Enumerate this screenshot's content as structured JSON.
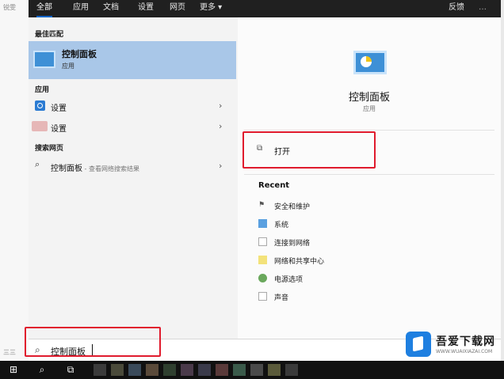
{
  "tabs": [
    {
      "label": "全部",
      "active": true
    },
    {
      "label": "应用"
    },
    {
      "label": "文档"
    },
    {
      "label": "设置"
    },
    {
      "label": "网页"
    },
    {
      "label": "更多 ▾"
    }
  ],
  "feedback_label": "反馈",
  "more_icon": "…",
  "desktop": {
    "frag_top": "锐雯",
    "frag_bottom": "三三"
  },
  "left": {
    "best_match_heading": "最佳匹配",
    "best_match": {
      "title": "控制面板",
      "subtitle": "应用",
      "icon": "control-panel-icon"
    },
    "apps_heading": "应用",
    "apps": [
      {
        "label": "设置",
        "icon": "settings-gear-icon"
      },
      {
        "label": "设置",
        "icon": "settings-pink-icon"
      }
    ],
    "web_heading": "搜索网页",
    "web_result": {
      "label": "控制面板",
      "sub": " - 查看网络搜索结果",
      "icon": "search-icon"
    }
  },
  "right": {
    "app_title": "控制面板",
    "app_subtitle": "应用",
    "open_label": "打开",
    "recent_heading": "Recent",
    "recent": [
      {
        "label": "安全和维护",
        "icon": "flag-icon"
      },
      {
        "label": "系统",
        "icon": "system-icon"
      },
      {
        "label": "连接到网络",
        "icon": "network-icon"
      },
      {
        "label": "网络和共享中心",
        "icon": "network-center-icon"
      },
      {
        "label": "电源选项",
        "icon": "power-icon"
      },
      {
        "label": "声音",
        "icon": "sound-icon"
      }
    ]
  },
  "search": {
    "value": "控制面板",
    "icon": "search-icon"
  },
  "watermark": {
    "title": "吾爱下载网",
    "url": "WWW.WUAIXIAZAI.COM"
  },
  "colors": {
    "accent": "#0a66c8",
    "highlight_box": "#e01b2d",
    "selection": "#a9c7e8"
  }
}
